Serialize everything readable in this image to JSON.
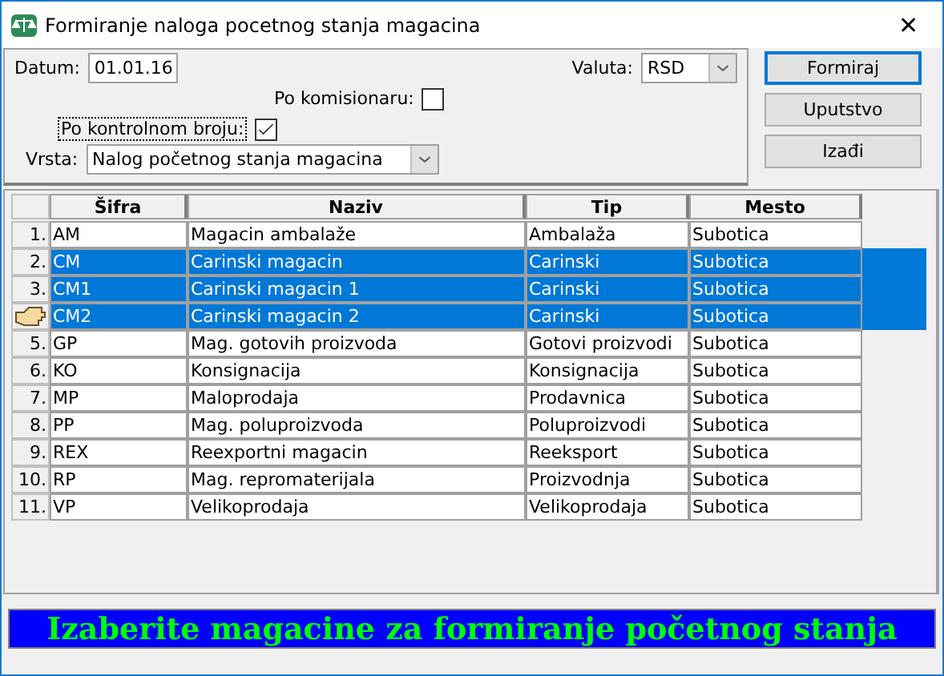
{
  "window": {
    "title": "Formiranje naloga pocetnog stanja magacina",
    "close": "✕"
  },
  "form": {
    "datum_label": "Datum:",
    "datum": "01.01.16",
    "valuta_label": "Valuta:",
    "valuta": "RSD",
    "komisionar_label": "Po komisionaru:",
    "komisionar_checked": false,
    "kontrolni_label": "Po kontrolnom broju:",
    "kontrolni_checked": true,
    "vrsta_label": "Vrsta:",
    "vrsta": "Nalog početnog stanja magacina"
  },
  "buttons": [
    {
      "label": "Formiraj",
      "default": true
    },
    {
      "label": "Uputstvo",
      "default": false
    },
    {
      "label": "Izađi",
      "default": false
    }
  ],
  "table": {
    "columns": [
      "Šifra",
      "Naziv",
      "Tip",
      "Mesto"
    ],
    "rows": [
      {
        "number": "1.",
        "cells": [
          "AM",
          "Magacin ambalaže",
          "Ambalaža",
          "Subotica"
        ],
        "selected": false
      },
      {
        "number": "2.",
        "cells": [
          "CM",
          "Carinski magacin",
          "Carinski",
          "Subotica"
        ],
        "selected": true
      },
      {
        "number": "3.",
        "cells": [
          "CM1",
          "Carinski magacin 1",
          "Carinski",
          "Subotica"
        ],
        "selected": true
      },
      {
        "cells": [
          "CM2",
          "Carinski magacin 2",
          "Carinski",
          "Subotica"
        ],
        "selected": true,
        "pointer": true
      },
      {
        "number": "5.",
        "cells": [
          "GP",
          "Mag. gotovih proizvoda",
          "Gotovi proizvodi",
          "Subotica"
        ],
        "selected": false
      },
      {
        "number": "6.",
        "cells": [
          "KO",
          "Konsignacija",
          "Konsignacija",
          "Subotica"
        ],
        "selected": false
      },
      {
        "number": "7.",
        "cells": [
          "MP",
          "Maloprodaja",
          "Prodavnica",
          "Subotica"
        ],
        "selected": false
      },
      {
        "number": "8.",
        "cells": [
          "PP",
          "Mag. poluproizvoda",
          "Poluproizvodi",
          "Subotica"
        ],
        "selected": false
      },
      {
        "number": "9.",
        "cells": [
          "REX",
          "Reexportni magacin",
          "Reeksport",
          "Subotica"
        ],
        "selected": false
      },
      {
        "number": "10.",
        "cells": [
          "RP",
          "Mag. repromaterijala",
          "Proizvodnja",
          "Subotica"
        ],
        "selected": false
      },
      {
        "number": "11.",
        "cells": [
          "VP",
          "Velikoprodaja",
          "Velikoprodaja",
          "Subotica"
        ],
        "selected": false
      }
    ]
  },
  "status_bar": "Izaberite magacine za formiranje početnog stanja"
}
